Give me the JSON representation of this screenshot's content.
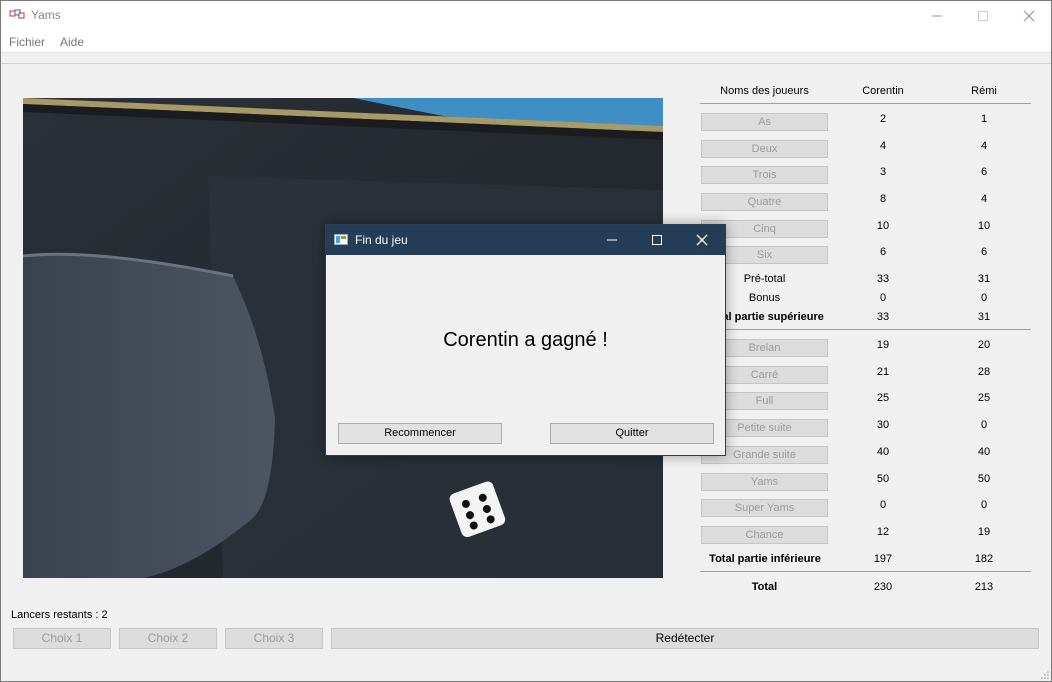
{
  "window": {
    "title": "Yams"
  },
  "menu": {
    "items": [
      "Fichier",
      "Aide"
    ]
  },
  "scoreboard": {
    "header": {
      "players_label": "Noms des joueurs",
      "player1": "Corentin",
      "player2": "Rémi"
    },
    "upper": [
      {
        "label": "As",
        "p1": "2",
        "p2": "1"
      },
      {
        "label": "Deux",
        "p1": "4",
        "p2": "4"
      },
      {
        "label": "Trois",
        "p1": "3",
        "p2": "6"
      },
      {
        "label": "Quatre",
        "p1": "8",
        "p2": "4"
      },
      {
        "label": "Cinq",
        "p1": "10",
        "p2": "10"
      },
      {
        "label": "Six",
        "p1": "6",
        "p2": "6"
      }
    ],
    "pretotal": {
      "label": "Pré-total",
      "p1": "33",
      "p2": "31"
    },
    "bonus": {
      "label": "Bonus",
      "p1": "0",
      "p2": "0"
    },
    "upper_total": {
      "label": "Total partie supérieure",
      "p1": "33",
      "p2": "31"
    },
    "lower": [
      {
        "label": "Brelan",
        "p1": "19",
        "p2": "20"
      },
      {
        "label": "Carré",
        "p1": "21",
        "p2": "28"
      },
      {
        "label": "Full",
        "p1": "25",
        "p2": "25"
      },
      {
        "label": "Petite suite",
        "p1": "30",
        "p2": "0"
      },
      {
        "label": "Grande suite",
        "p1": "40",
        "p2": "40"
      },
      {
        "label": "Yams",
        "p1": "50",
        "p2": "50"
      },
      {
        "label": "Super Yams",
        "p1": "0",
        "p2": "0"
      },
      {
        "label": "Chance",
        "p1": "12",
        "p2": "19"
      }
    ],
    "lower_total": {
      "label": "Total partie inférieure",
      "p1": "197",
      "p2": "182"
    },
    "total": {
      "label": "Total",
      "p1": "230",
      "p2": "213"
    }
  },
  "status": {
    "throws_label": "Lancers restants :  2"
  },
  "bottom": {
    "choice1": "Choix 1",
    "choice2": "Choix 2",
    "choice3": "Choix 3",
    "redetect": "Redétecter"
  },
  "dialog": {
    "title": "Fin du jeu",
    "message": "Corentin a gagné !",
    "restart": "Recommencer",
    "quit": "Quitter"
  },
  "colors": {
    "dialog_titlebar": "#253d57",
    "disabled_text": "#9a9a9a"
  },
  "icons": [
    "app-icon",
    "minimize-icon",
    "maximize-icon",
    "close-icon",
    "dialog-app-icon"
  ]
}
